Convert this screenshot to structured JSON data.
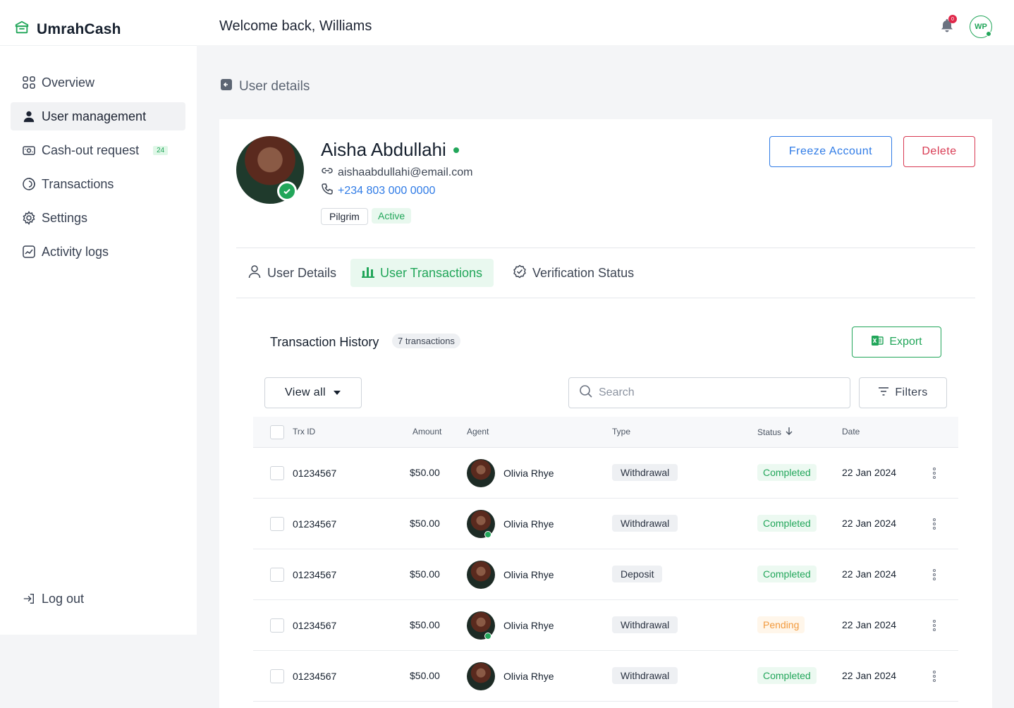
{
  "app": {
    "name": "UmrahCash"
  },
  "header": {
    "welcome": "Welcome back, Williams",
    "notification_count": "0",
    "user_initials": "WP"
  },
  "sidebar": {
    "items": [
      {
        "label": "Overview",
        "icon": "grid-icon"
      },
      {
        "label": "User management",
        "icon": "user-icon",
        "active": true
      },
      {
        "label": "Cash-out request",
        "icon": "cash-icon",
        "badge": "24"
      },
      {
        "label": "Transactions",
        "icon": "transactions-icon"
      },
      {
        "label": "Settings",
        "icon": "gear-icon"
      },
      {
        "label": "Activity logs",
        "icon": "activity-icon"
      }
    ],
    "logout": "Log out"
  },
  "page": {
    "title": "User details"
  },
  "profile": {
    "name": "Aisha Abdullahi",
    "email": "aishaabdullahi@email.com",
    "phone": "+234 803 000 0000",
    "role_tag": "Pilgrim",
    "status_tag": "Active",
    "freeze_label": "Freeze Account",
    "delete_label": "Delete"
  },
  "tabs": [
    {
      "label": "User Details"
    },
    {
      "label": "User Transactions",
      "active": true
    },
    {
      "label": "Verification Status"
    }
  ],
  "history": {
    "title": "Transaction History",
    "count": "7 transactions",
    "export_label": "Export",
    "view_all_label": "View all",
    "search_placeholder": "Search",
    "filters_label": "Filters"
  },
  "table": {
    "columns": {
      "trx_id": "Trx ID",
      "amount": "Amount",
      "agent": "Agent",
      "type": "Type",
      "status": "Status",
      "date": "Date"
    },
    "rows": [
      {
        "trx_id": "01234567",
        "amount": "$50.00",
        "agent": "Olivia Rhye",
        "agent_online": false,
        "type": "Withdrawal",
        "status": "Completed",
        "date": "22 Jan 2024"
      },
      {
        "trx_id": "01234567",
        "amount": "$50.00",
        "agent": "Olivia Rhye",
        "agent_online": true,
        "type": "Withdrawal",
        "status": "Completed",
        "date": "22 Jan 2024"
      },
      {
        "trx_id": "01234567",
        "amount": "$50.00",
        "agent": "Olivia Rhye",
        "agent_online": false,
        "type": "Deposit",
        "status": "Completed",
        "date": "22 Jan 2024"
      },
      {
        "trx_id": "01234567",
        "amount": "$50.00",
        "agent": "Olivia Rhye",
        "agent_online": true,
        "type": "Withdrawal",
        "status": "Pending",
        "date": "22 Jan 2024"
      },
      {
        "trx_id": "01234567",
        "amount": "$50.00",
        "agent": "Olivia Rhye",
        "agent_online": false,
        "type": "Withdrawal",
        "status": "Completed",
        "date": "22 Jan 2024"
      }
    ]
  },
  "colors": {
    "brand_green": "#22a65a",
    "link_blue": "#2f7be6",
    "danger_red": "#d83a52",
    "pending_orange": "#f29a3d"
  }
}
